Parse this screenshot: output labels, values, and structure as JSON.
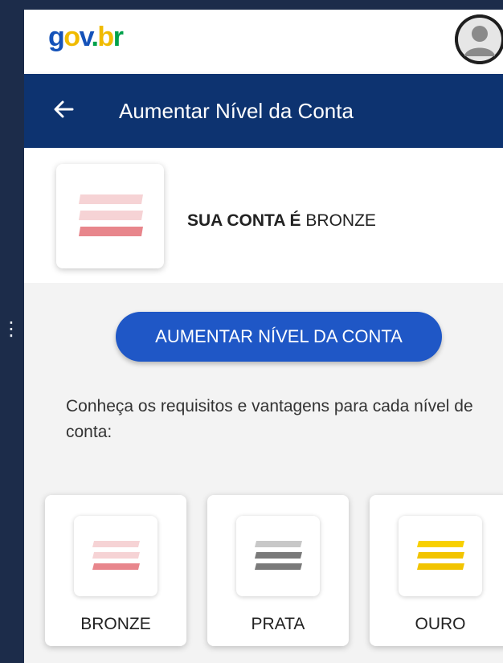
{
  "window_edge": {
    "glyph": "⋮"
  },
  "header": {
    "logo_parts": {
      "g": "g",
      "o": "o",
      "v": "v",
      "dot": ".",
      "b": "b",
      "r": "r"
    },
    "avatar_icon": "user-avatar"
  },
  "nav": {
    "back_icon": "arrow-left-icon",
    "title": "Aumentar Nível da Conta"
  },
  "account": {
    "status_label": "SUA CONTA É",
    "status_level": "BRONZE"
  },
  "cta": {
    "label": "AUMENTAR NÍVEL DA CONTA"
  },
  "info": {
    "text": "Conheça os requisitos e vantagens para cada nível de conta:"
  },
  "levels": [
    {
      "label": "BRONZE",
      "color_light": "#f6d3d5",
      "color_dark": "#e8868c"
    },
    {
      "label": "PRATA",
      "color_light": "#c8c8c8",
      "color_dark": "#7a7a7a"
    },
    {
      "label": "OURO",
      "color_light": "#f8d000",
      "color_dark": "#f2c400"
    }
  ],
  "colors": {
    "brand_blue": "#0d3370",
    "button_blue": "#1f57c6",
    "outer_bg": "#1c2c4a"
  }
}
